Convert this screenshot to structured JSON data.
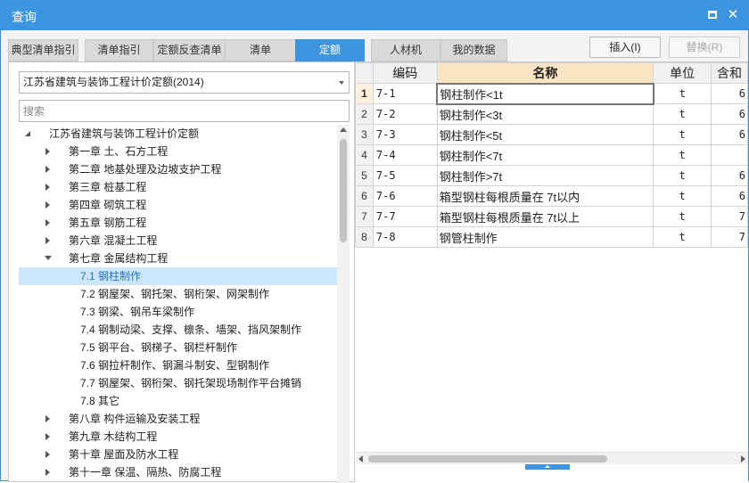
{
  "window": {
    "title": "查询",
    "maximize_icon": "maximize-icon",
    "close_icon": "close-icon",
    "close_glyph": "✕"
  },
  "tabs": [
    {
      "label": "典型清单指引",
      "active": false
    },
    {
      "label": "清单指引",
      "active": false
    },
    {
      "label": "定额反查清单",
      "active": false
    },
    {
      "label": "清单",
      "active": false
    },
    {
      "label": "定额",
      "active": true
    },
    {
      "label": "人材机",
      "active": false
    },
    {
      "label": "我的数据",
      "active": false
    }
  ],
  "actions": {
    "insert_label": "插入(I)",
    "replace_label": "替换(R)"
  },
  "left": {
    "library_select": "江苏省建筑与装饰工程计价定额(2014)",
    "search_placeholder": "搜索",
    "tree": [
      {
        "label": "江苏省建筑与装饰工程计价定额",
        "level": 0,
        "state": "expanded-root"
      },
      {
        "label": "第一章 土、石方工程",
        "level": 1,
        "state": "collapsed"
      },
      {
        "label": "第二章 地基处理及边坡支护工程",
        "level": 1,
        "state": "collapsed"
      },
      {
        "label": "第三章 桩基工程",
        "level": 1,
        "state": "collapsed"
      },
      {
        "label": "第四章 砌筑工程",
        "level": 1,
        "state": "collapsed"
      },
      {
        "label": "第五章 钢筋工程",
        "level": 1,
        "state": "collapsed"
      },
      {
        "label": "第六章 混凝土工程",
        "level": 1,
        "state": "collapsed"
      },
      {
        "label": "第七章 金属结构工程",
        "level": 1,
        "state": "expanded"
      },
      {
        "label": "7.1 钢柱制作",
        "level": 2,
        "state": "leaf",
        "selected": true
      },
      {
        "label": "7.2 钢屋架、钢托架、钢桁架、网架制作",
        "level": 2,
        "state": "leaf"
      },
      {
        "label": "7.3 钢梁、钢吊车梁制作",
        "level": 2,
        "state": "leaf"
      },
      {
        "label": "7.4 钢制动梁、支撑、檩条、墙架、挡风架制作",
        "level": 2,
        "state": "leaf"
      },
      {
        "label": "7.5 钢平台、钢梯子、钢栏杆制作",
        "level": 2,
        "state": "leaf"
      },
      {
        "label": "7.6 钢拉杆制作、钢漏斗制安、型钢制作",
        "level": 2,
        "state": "leaf"
      },
      {
        "label": "7.7 钢屋架、钢桁架、钢托架现场制作平台摊销",
        "level": 2,
        "state": "leaf"
      },
      {
        "label": "7.8 其它",
        "level": 2,
        "state": "leaf"
      },
      {
        "label": "第八章 构件运输及安装工程",
        "level": 1,
        "state": "collapsed"
      },
      {
        "label": "第九章 木结构工程",
        "level": 1,
        "state": "collapsed"
      },
      {
        "label": "第十章 屋面及防水工程",
        "level": 1,
        "state": "collapsed"
      },
      {
        "label": "第十一章 保温、隔热、防腐工程",
        "level": 1,
        "state": "collapsed"
      }
    ]
  },
  "grid": {
    "headers": [
      "",
      "编码",
      "名称",
      "单位",
      "含和"
    ],
    "rows": [
      {
        "idx": "1",
        "code": "7-1",
        "name": "钢柱制作<1t",
        "unit": "t",
        "extra": "6"
      },
      {
        "idx": "2",
        "code": "7-2",
        "name": "钢柱制作<3t",
        "unit": "t",
        "extra": "6"
      },
      {
        "idx": "3",
        "code": "7-3",
        "name": "钢柱制作<5t",
        "unit": "t",
        "extra": "6"
      },
      {
        "idx": "4",
        "code": "7-4",
        "name": "钢柱制作<7t",
        "unit": "t",
        "extra": ""
      },
      {
        "idx": "5",
        "code": "7-5",
        "name": "钢柱制作>7t",
        "unit": "t",
        "extra": "6"
      },
      {
        "idx": "6",
        "code": "7-6",
        "name": "箱型钢柱每根质量在 7t以内",
        "unit": "t",
        "extra": "6"
      },
      {
        "idx": "7",
        "code": "7-7",
        "name": "箱型钢柱每根质量在 7t以上",
        "unit": "t",
        "extra": "7"
      },
      {
        "idx": "8",
        "code": "7-8",
        "name": "钢管柱制作",
        "unit": "t",
        "extra": "7"
      }
    ]
  },
  "colors": {
    "accent": "#3e95df",
    "tree_selected": "#cce6fb",
    "header_highlight": "#fbe4c3"
  }
}
